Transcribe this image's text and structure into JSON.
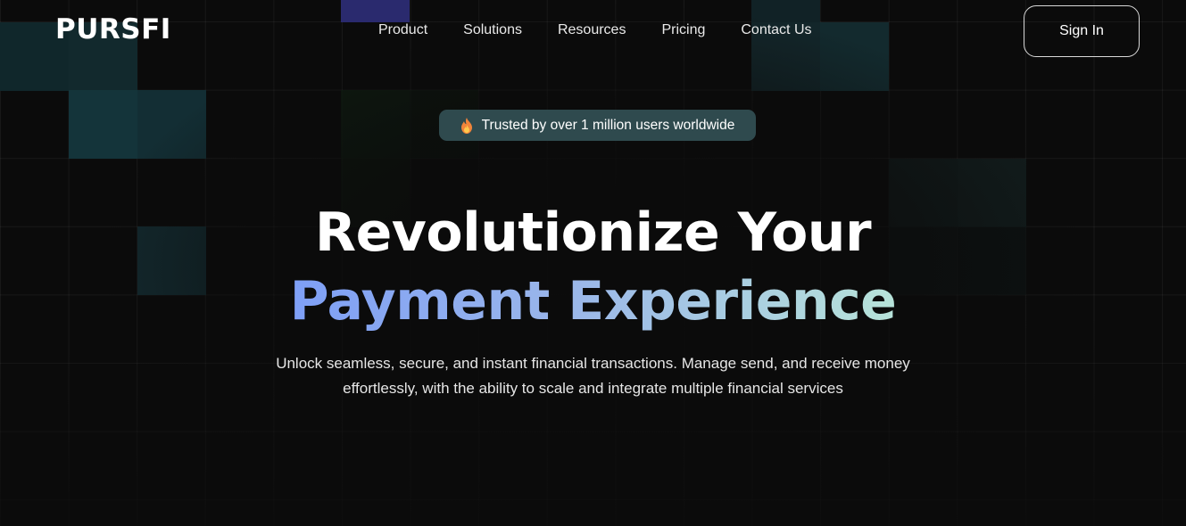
{
  "header": {
    "logo": "PURSFI",
    "nav": [
      "Product",
      "Solutions",
      "Resources",
      "Pricing",
      "Contact Us"
    ],
    "sign_in": "Sign In"
  },
  "badge": {
    "icon": "fire-icon",
    "text": "Trusted by over 1 million users worldwide"
  },
  "hero": {
    "title_line1": "Revolutionize Your",
    "title_line2": "Payment Experience",
    "subtitle": "Unlock seamless, secure, and instant financial transactions. Manage send, and receive money effortlessly, with the ability to scale and integrate multiple financial services"
  },
  "colors": {
    "background": "#0b0b0b",
    "badge_bg": "#2f4a4e",
    "gradient_start": "#7e9ff6",
    "gradient_end": "#b7e3d9"
  }
}
